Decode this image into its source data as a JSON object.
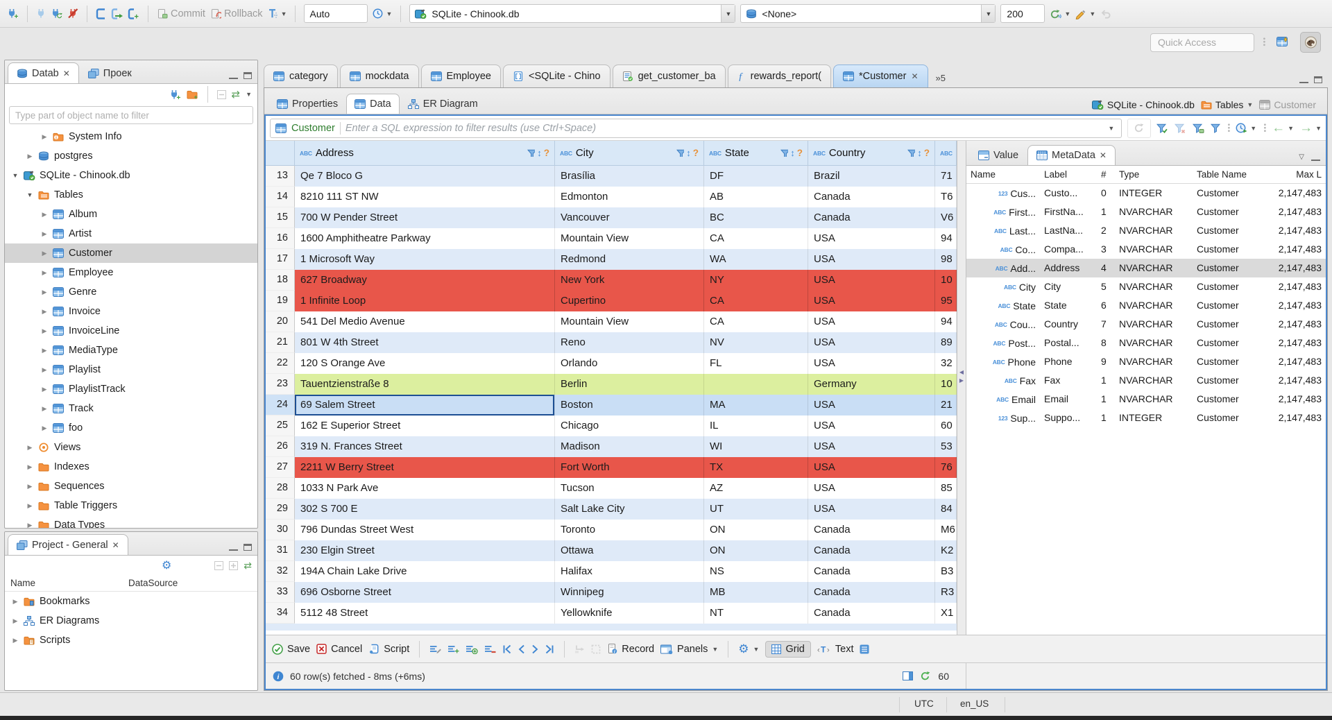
{
  "colors": {
    "accent": "#4b87cd",
    "row_alt": "#dfeaf8",
    "row_error": "#e8564a",
    "row_special": "#dcef9f",
    "row_selected": "#c9def5",
    "header_bg": "#d9e8f7"
  },
  "main_toolbar": {
    "commit_label": "Commit",
    "rollback_label": "Rollback",
    "auto_commit": "Auto",
    "connection": "SQLite - Chinook.db",
    "schema": "<None>",
    "fetch_size": "200",
    "quick_access_placeholder": "Quick Access"
  },
  "navigator": {
    "tab_database": "Datab",
    "tab_projects": "Проек",
    "filter_placeholder": "Type part of object name to filter",
    "tree": [
      {
        "label": "System Info",
        "icon": "folder-info",
        "depth": 2,
        "arrow": "collapsed"
      },
      {
        "label": "postgres",
        "icon": "db",
        "depth": 1,
        "arrow": "collapsed"
      },
      {
        "label": "SQLite - Chinook.db",
        "icon": "db-sqlite",
        "depth": 0,
        "arrow": "expanded"
      },
      {
        "label": "Tables",
        "icon": "folder-table",
        "depth": 1,
        "arrow": "expanded"
      },
      {
        "label": "Album",
        "icon": "table",
        "depth": 2,
        "arrow": "collapsed"
      },
      {
        "label": "Artist",
        "icon": "table",
        "depth": 2,
        "arrow": "collapsed"
      },
      {
        "label": "Customer",
        "icon": "table",
        "depth": 2,
        "arrow": "collapsed",
        "selected": true
      },
      {
        "label": "Employee",
        "icon": "table",
        "depth": 2,
        "arrow": "collapsed"
      },
      {
        "label": "Genre",
        "icon": "table",
        "depth": 2,
        "arrow": "collapsed"
      },
      {
        "label": "Invoice",
        "icon": "table",
        "depth": 2,
        "arrow": "collapsed"
      },
      {
        "label": "InvoiceLine",
        "icon": "table",
        "depth": 2,
        "arrow": "collapsed"
      },
      {
        "label": "MediaType",
        "icon": "table",
        "depth": 2,
        "arrow": "collapsed"
      },
      {
        "label": "Playlist",
        "icon": "table",
        "depth": 2,
        "arrow": "collapsed"
      },
      {
        "label": "PlaylistTrack",
        "icon": "table",
        "depth": 2,
        "arrow": "collapsed"
      },
      {
        "label": "Track",
        "icon": "table",
        "depth": 2,
        "arrow": "collapsed"
      },
      {
        "label": "foo",
        "icon": "table",
        "depth": 2,
        "arrow": "collapsed"
      },
      {
        "label": "Views",
        "icon": "eye",
        "depth": 1,
        "arrow": "collapsed"
      },
      {
        "label": "Indexes",
        "icon": "folder",
        "depth": 1,
        "arrow": "collapsed"
      },
      {
        "label": "Sequences",
        "icon": "folder",
        "depth": 1,
        "arrow": "collapsed"
      },
      {
        "label": "Table Triggers",
        "icon": "folder",
        "depth": 1,
        "arrow": "collapsed"
      },
      {
        "label": "Data Types",
        "icon": "folder",
        "depth": 1,
        "arrow": "collapsed"
      }
    ]
  },
  "project_panel": {
    "title": "Project - General",
    "name_column": "Name",
    "datasource_column": "DataSource",
    "items": [
      {
        "label": "Bookmarks",
        "icon": "folder-bookmark"
      },
      {
        "label": "ER Diagrams",
        "icon": "er"
      },
      {
        "label": "Scripts",
        "icon": "folder-script"
      }
    ]
  },
  "editor": {
    "tabs": [
      {
        "label": "category",
        "icon": "table"
      },
      {
        "label": "mockdata",
        "icon": "table"
      },
      {
        "label": "Employee",
        "icon": "table"
      },
      {
        "label": "<SQLite - Chino",
        "icon": "sql"
      },
      {
        "label": "get_customer_ba",
        "icon": "script"
      },
      {
        "label": "rewards_report(",
        "icon": "function"
      },
      {
        "label": "*Customer",
        "icon": "table",
        "active": true,
        "close": true
      }
    ],
    "overflow_badge": "»5",
    "subtabs": [
      {
        "label": "Properties",
        "icon": "table"
      },
      {
        "label": "Data",
        "icon": "table",
        "active": true
      },
      {
        "label": "ER Diagram",
        "icon": "er"
      }
    ],
    "breadcrumb": [
      {
        "label": "SQLite - Chinook.db",
        "icon": "db-sqlite"
      },
      {
        "label": "Tables",
        "icon": "folder-table",
        "dropdown": true
      },
      {
        "label": "Customer",
        "icon": "table-muted",
        "muted": true
      }
    ]
  },
  "filter_bar": {
    "entity": "Customer",
    "placeholder": "Enter a SQL expression to filter results (use Ctrl+Space)"
  },
  "grid": {
    "columns": [
      "Address",
      "City",
      "State",
      "Country",
      ""
    ],
    "rows": [
      {
        "num": "13",
        "style": "alt",
        "cells": [
          "Qe 7 Bloco G",
          "Brasília",
          "DF",
          "Brazil",
          "71"
        ]
      },
      {
        "num": "14",
        "style": "plain",
        "cells": [
          "8210 111 ST NW",
          "Edmonton",
          "AB",
          "Canada",
          "T6"
        ]
      },
      {
        "num": "15",
        "style": "alt",
        "cells": [
          "700 W Pender Street",
          "Vancouver",
          "BC",
          "Canada",
          "V6"
        ]
      },
      {
        "num": "16",
        "style": "plain",
        "cells": [
          "1600 Amphitheatre Parkway",
          "Mountain View",
          "CA",
          "USA",
          "94"
        ]
      },
      {
        "num": "17",
        "style": "alt",
        "cells": [
          "1 Microsoft Way",
          "Redmond",
          "WA",
          "USA",
          "98"
        ]
      },
      {
        "num": "18",
        "style": "error",
        "cells": [
          "627 Broadway",
          "New York",
          "NY",
          "USA",
          "10"
        ]
      },
      {
        "num": "19",
        "style": "error",
        "cells": [
          "1 Infinite Loop",
          "Cupertino",
          "CA",
          "USA",
          "95"
        ]
      },
      {
        "num": "20",
        "style": "plain",
        "cells": [
          "541 Del Medio Avenue",
          "Mountain View",
          "CA",
          "USA",
          "94"
        ]
      },
      {
        "num": "21",
        "style": "alt",
        "cells": [
          "801 W 4th Street",
          "Reno",
          "NV",
          "USA",
          "89"
        ]
      },
      {
        "num": "22",
        "style": "plain",
        "cells": [
          "120 S Orange Ave",
          "Orlando",
          "FL",
          "USA",
          "32"
        ]
      },
      {
        "num": "23",
        "style": "special",
        "cells": [
          "Tauentzienstraße 8",
          "Berlin",
          "",
          "Germany",
          "10"
        ]
      },
      {
        "num": "24",
        "style": "selected",
        "cells": [
          "69 Salem Street",
          "Boston",
          "MA",
          "USA",
          "21"
        ],
        "focus_col": 0
      },
      {
        "num": "25",
        "style": "plain",
        "cells": [
          "162 E Superior Street",
          "Chicago",
          "IL",
          "USA",
          "60"
        ]
      },
      {
        "num": "26",
        "style": "alt",
        "cells": [
          "319 N. Frances Street",
          "Madison",
          "WI",
          "USA",
          "53"
        ]
      },
      {
        "num": "27",
        "style": "error",
        "cells": [
          "2211 W Berry Street",
          "Fort Worth",
          "TX",
          "USA",
          "76"
        ]
      },
      {
        "num": "28",
        "style": "plain",
        "cells": [
          "1033 N Park Ave",
          "Tucson",
          "AZ",
          "USA",
          "85"
        ]
      },
      {
        "num": "29",
        "style": "alt",
        "cells": [
          "302 S 700 E",
          "Salt Lake City",
          "UT",
          "USA",
          "84"
        ]
      },
      {
        "num": "30",
        "style": "plain",
        "cells": [
          "796 Dundas Street West",
          "Toronto",
          "ON",
          "Canada",
          "M6"
        ]
      },
      {
        "num": "31",
        "style": "alt",
        "cells": [
          "230 Elgin Street",
          "Ottawa",
          "ON",
          "Canada",
          "K2"
        ]
      },
      {
        "num": "32",
        "style": "plain",
        "cells": [
          "194A Chain Lake Drive",
          "Halifax",
          "NS",
          "Canada",
          "B3"
        ]
      },
      {
        "num": "33",
        "style": "alt",
        "cells": [
          "696 Osborne Street",
          "Winnipeg",
          "MB",
          "Canada",
          "R3"
        ]
      },
      {
        "num": "34",
        "style": "plain",
        "cells": [
          "5112 48 Street",
          "Yellowknife",
          "NT",
          "Canada",
          "X1"
        ]
      }
    ]
  },
  "side_panel": {
    "tab_value": "Value",
    "tab_metadata": "MetaData",
    "columns": [
      "Name",
      "Label",
      "#",
      "Type",
      "Table Name",
      "Max L"
    ],
    "rows": [
      {
        "kind": "123",
        "name": "Cus...",
        "label": "Custo...",
        "ord": "0",
        "type": "INTEGER",
        "table": "Customer",
        "max": "2,147,483"
      },
      {
        "kind": "ABC",
        "name": "First...",
        "label": "FirstNa...",
        "ord": "1",
        "type": "NVARCHAR",
        "table": "Customer",
        "max": "2,147,483"
      },
      {
        "kind": "ABC",
        "name": "Last...",
        "label": "LastNa...",
        "ord": "2",
        "type": "NVARCHAR",
        "table": "Customer",
        "max": "2,147,483"
      },
      {
        "kind": "ABC",
        "name": "Co...",
        "label": "Compa...",
        "ord": "3",
        "type": "NVARCHAR",
        "table": "Customer",
        "max": "2,147,483"
      },
      {
        "kind": "ABC",
        "name": "Add...",
        "label": "Address",
        "ord": "4",
        "type": "NVARCHAR",
        "table": "Customer",
        "max": "2,147,483",
        "selected": true
      },
      {
        "kind": "ABC",
        "name": "City",
        "label": "City",
        "ord": "5",
        "type": "NVARCHAR",
        "table": "Customer",
        "max": "2,147,483"
      },
      {
        "kind": "ABC",
        "name": "State",
        "label": "State",
        "ord": "6",
        "type": "NVARCHAR",
        "table": "Customer",
        "max": "2,147,483"
      },
      {
        "kind": "ABC",
        "name": "Cou...",
        "label": "Country",
        "ord": "7",
        "type": "NVARCHAR",
        "table": "Customer",
        "max": "2,147,483"
      },
      {
        "kind": "ABC",
        "name": "Post...",
        "label": "Postal...",
        "ord": "8",
        "type": "NVARCHAR",
        "table": "Customer",
        "max": "2,147,483"
      },
      {
        "kind": "ABC",
        "name": "Phone",
        "label": "Phone",
        "ord": "9",
        "type": "NVARCHAR",
        "table": "Customer",
        "max": "2,147,483"
      },
      {
        "kind": "ABC",
        "name": "Fax",
        "label": "Fax",
        "ord": "1",
        "type": "NVARCHAR",
        "table": "Customer",
        "max": "2,147,483"
      },
      {
        "kind": "ABC",
        "name": "Email",
        "label": "Email",
        "ord": "1",
        "type": "NVARCHAR",
        "table": "Customer",
        "max": "2,147,483"
      },
      {
        "kind": "123",
        "name": "Sup...",
        "label": "Suppo...",
        "ord": "1",
        "type": "INTEGER",
        "table": "Customer",
        "max": "2,147,483"
      }
    ]
  },
  "footer": {
    "save": "Save",
    "cancel": "Cancel",
    "script": "Script",
    "record": "Record",
    "panels": "Panels",
    "grid": "Grid",
    "text": "Text"
  },
  "status_row": {
    "message": "60 row(s) fetched - 8ms (+6ms)",
    "refresh_count": "60"
  },
  "window_status": {
    "timezone": "UTC",
    "locale": "en_US"
  }
}
